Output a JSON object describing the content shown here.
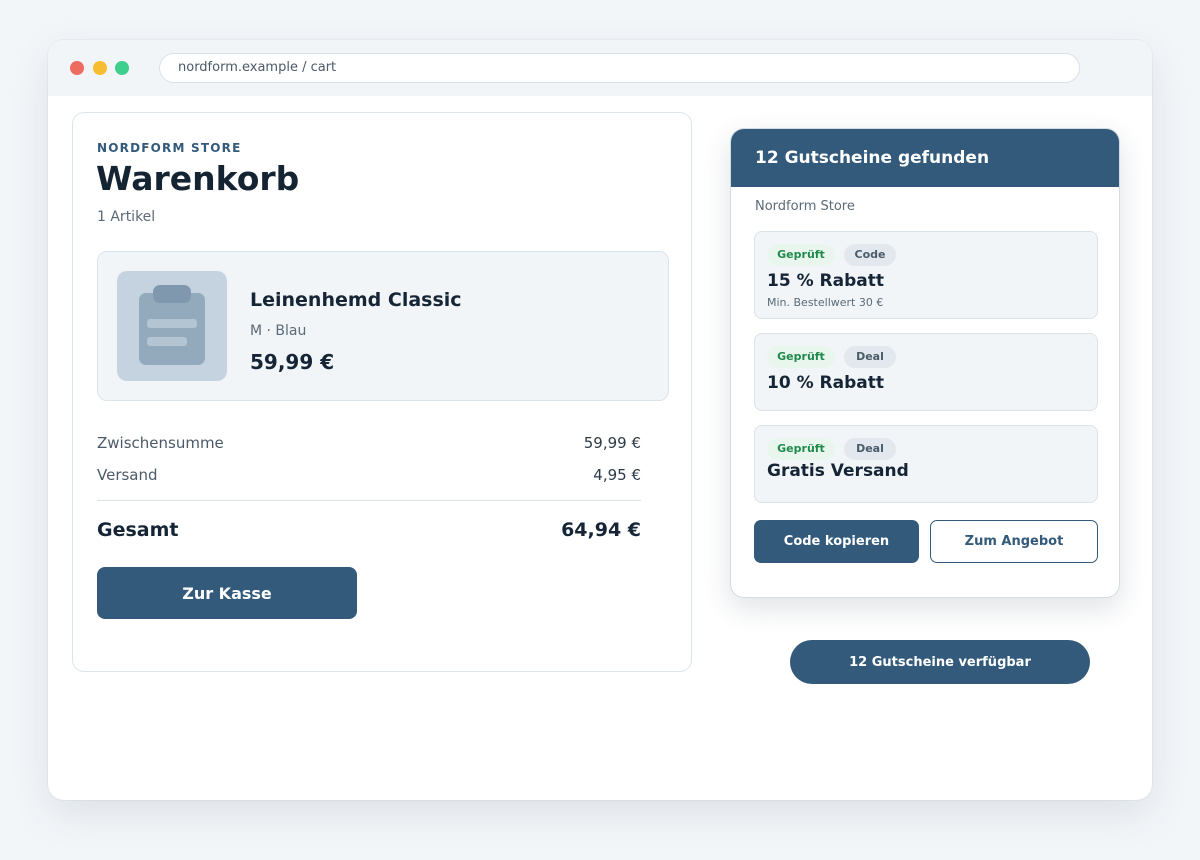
{
  "browser": {
    "url": "nordform.example / cart"
  },
  "cart": {
    "store_label": "NORDFORM STORE",
    "title": "Warenkorb",
    "item_count": "1 Artikel",
    "product": {
      "name": "Leinenhemd Classic",
      "variant": "M · Blau",
      "price": "59,99 €",
      "thumbnail_icon": "clipboard-icon"
    },
    "subtotal": {
      "label": "Zwischensumme",
      "value": "59,99 €"
    },
    "shipping": {
      "label": "Versand",
      "value": "4,95 €"
    },
    "total": {
      "label": "Gesamt",
      "value": "64,94 €"
    },
    "checkout_label": "Zur Kasse"
  },
  "coupons": {
    "header": "12 Gutscheine gefunden",
    "store": "Nordform Store",
    "items": [
      {
        "verified": "Geprüft",
        "type": "Code",
        "title": "15 % Rabatt",
        "note": "Min. Bestellwert 30 €"
      },
      {
        "verified": "Geprüft",
        "type": "Deal",
        "title": "10 % Rabatt",
        "note": ""
      },
      {
        "verified": "Geprüft",
        "type": "Deal",
        "title": "Gratis Versand",
        "note": ""
      }
    ],
    "copy_label": "Code kopieren",
    "offer_label": "Zum Angebot",
    "available_label": "12 Gutscheine verfügbar"
  },
  "colors": {
    "accent": "#335a7a",
    "verified_green": "#1f8a4c",
    "window_close": "#ee6b60",
    "window_minimize": "#f5bd2f",
    "window_maximize": "#3ecf8a"
  }
}
